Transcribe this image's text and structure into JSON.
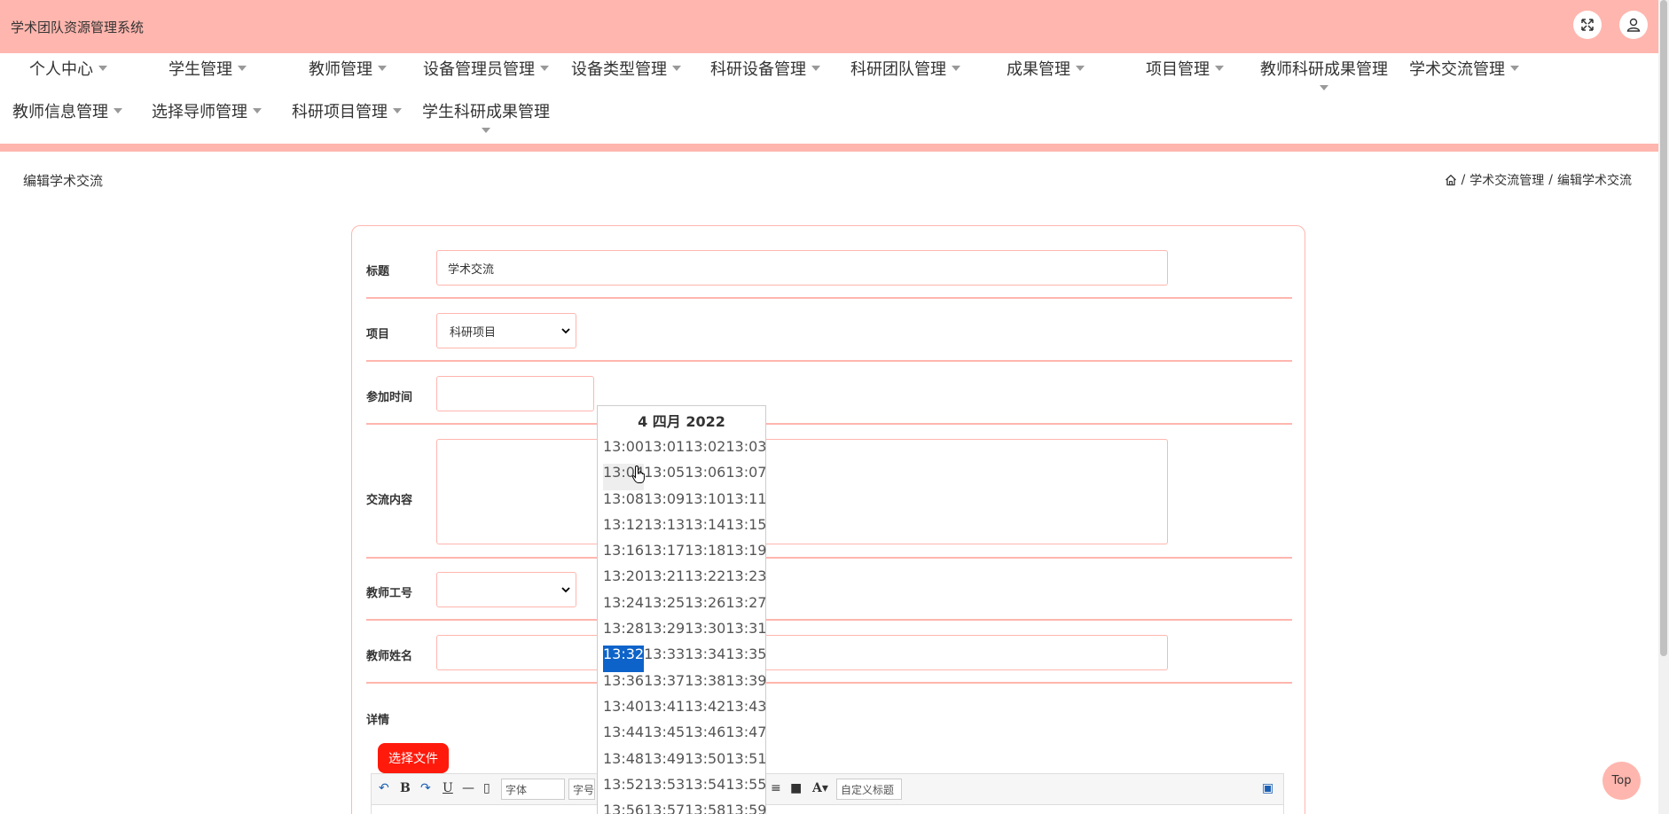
{
  "app": {
    "title": "学术团队资源管理系统"
  },
  "nav": {
    "row1": [
      "个人中心",
      "学生管理",
      "教师管理",
      "设备管理员管理",
      "设备类型管理",
      "科研设备管理",
      "科研团队管理",
      "成果管理",
      "项目管理",
      "教师科研成果管理",
      "学术交流管理"
    ],
    "row2": [
      "教师信息管理",
      "选择导师管理",
      "科研项目管理",
      "学生科研成果管理"
    ]
  },
  "page": {
    "title": "编辑学术交流",
    "breadcrumb": [
      "学术交流管理",
      "编辑学术交流"
    ],
    "breadcrumb_sep": "/"
  },
  "form": {
    "title": {
      "label": "标题",
      "value": "学术交流"
    },
    "project": {
      "label": "项目",
      "value": "科研项目"
    },
    "join_time": {
      "label": "参加时间",
      "value": ""
    },
    "content": {
      "label": "交流内容",
      "value": ""
    },
    "teacher_id": {
      "label": "教师工号",
      "value": ""
    },
    "teacher_name": {
      "label": "教师姓名",
      "value": ""
    },
    "detail": {
      "label": "详情"
    },
    "file_button": "选择文件"
  },
  "editor": {
    "font_select": "字体",
    "size_select": "字号",
    "heading_select": "自定义标题"
  },
  "datepicker": {
    "header": "4 四月 2022",
    "selected": "13:32",
    "hovered": "13:04",
    "rows": [
      [
        "13:00",
        "13:01",
        "13:02",
        "13:03"
      ],
      [
        "13:04",
        "13:05",
        "13:06",
        "13:07"
      ],
      [
        "13:08",
        "13:09",
        "13:10",
        "13:11"
      ],
      [
        "13:12",
        "13:13",
        "13:14",
        "13:15"
      ],
      [
        "13:16",
        "13:17",
        "13:18",
        "13:19"
      ],
      [
        "13:20",
        "13:21",
        "13:22",
        "13:23"
      ],
      [
        "13:24",
        "13:25",
        "13:26",
        "13:27"
      ],
      [
        "13:28",
        "13:29",
        "13:30",
        "13:31"
      ],
      [
        "13:32",
        "13:33",
        "13:34",
        "13:35"
      ],
      [
        "13:36",
        "13:37",
        "13:38",
        "13:39"
      ],
      [
        "13:40",
        "13:41",
        "13:42",
        "13:43"
      ],
      [
        "13:44",
        "13:45",
        "13:46",
        "13:47"
      ],
      [
        "13:48",
        "13:49",
        "13:50",
        "13:51"
      ],
      [
        "13:52",
        "13:53",
        "13:54",
        "13:55"
      ],
      [
        "13:56",
        "13:57",
        "13:58",
        "13:59"
      ]
    ]
  },
  "top_button": "Top",
  "colors": {
    "accent": "#ffb6ae",
    "primary_btn": "#ff1a0b",
    "selected": "#0d63c9"
  }
}
